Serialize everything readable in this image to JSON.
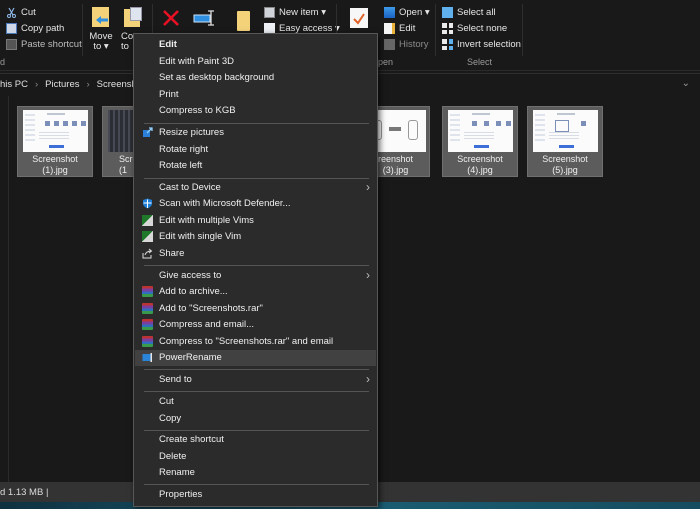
{
  "ribbon": {
    "clipboard": {
      "cut": "Cut",
      "copy_path": "Copy path",
      "paste_shortcut": "Paste shortcut",
      "group_label_partial": "d"
    },
    "organize": {
      "move_to": "Move",
      "move_to_line2": "to ▾",
      "copy_to": "Co",
      "copy_to_line2": "to"
    },
    "new": {
      "new_item": "New item ▾",
      "easy_access": "Easy access ▾"
    },
    "open": {
      "open": "Open ▾",
      "edit": "Edit",
      "history": "History",
      "group_label_partial": "pen"
    },
    "select": {
      "select_all": "Select all",
      "select_none": "Select none",
      "invert_selection": "Invert selection",
      "group_label": "Select"
    }
  },
  "address_bar": {
    "crumbs": [
      "his PC",
      "Pictures",
      "Screensho"
    ],
    "separator": "›",
    "dropdown": "⌄"
  },
  "files": [
    {
      "name_line1": "Screenshot",
      "name_line2": "(1).jpg"
    },
    {
      "name_line1": "Scre",
      "name_line2": "(1"
    },
    {
      "name_line1": "reenshot",
      "name_line2": "(3).jpg"
    },
    {
      "name_line1": "Screenshot",
      "name_line2": "(4).jpg"
    },
    {
      "name_line1": "Screenshot",
      "name_line2": "(5).jpg"
    }
  ],
  "status_bar": {
    "text": "d  1.13 MB  |"
  },
  "context_menu": {
    "items": [
      {
        "label": "Edit",
        "bold": true
      },
      {
        "label": "Edit with Paint 3D"
      },
      {
        "label": "Set as desktop background"
      },
      {
        "label": "Print"
      },
      {
        "label": "Compress to KGB"
      },
      {
        "label": "Resize pictures",
        "icon": "resize-pictures-icon"
      },
      {
        "label": "Rotate right"
      },
      {
        "label": "Rotate left"
      },
      {
        "label": "Cast to Device",
        "submenu": true
      },
      {
        "label": "Scan with Microsoft Defender...",
        "icon": "defender-shield-icon"
      },
      {
        "label": "Edit with multiple Vims",
        "icon": "vim-icon"
      },
      {
        "label": "Edit with single Vim",
        "icon": "vim-icon"
      },
      {
        "label": "Share",
        "icon": "share-icon"
      },
      {
        "label": "Give access to",
        "submenu": true
      },
      {
        "label": "Add to archive...",
        "icon": "winrar-icon"
      },
      {
        "label": "Add to \"Screenshots.rar\"",
        "icon": "winrar-icon"
      },
      {
        "label": "Compress and email...",
        "icon": "winrar-icon"
      },
      {
        "label": "Compress to \"Screenshots.rar\" and email",
        "icon": "winrar-icon"
      },
      {
        "label": "PowerRename",
        "icon": "powerrename-icon",
        "highlighted": true
      },
      {
        "label": "Send to",
        "submenu": true
      },
      {
        "label": "Cut"
      },
      {
        "label": "Copy"
      },
      {
        "label": "Create shortcut"
      },
      {
        "label": "Delete"
      },
      {
        "label": "Rename"
      },
      {
        "label": "Properties"
      }
    ],
    "submenu_arrow": "›"
  },
  "colors": {
    "background": "#191919",
    "menu_background": "#2b2b2b",
    "menu_highlight": "#414141",
    "selected_tile": "#5c5c5c",
    "accent_blue": "#3d8fe0",
    "delete_red": "#e81123"
  }
}
